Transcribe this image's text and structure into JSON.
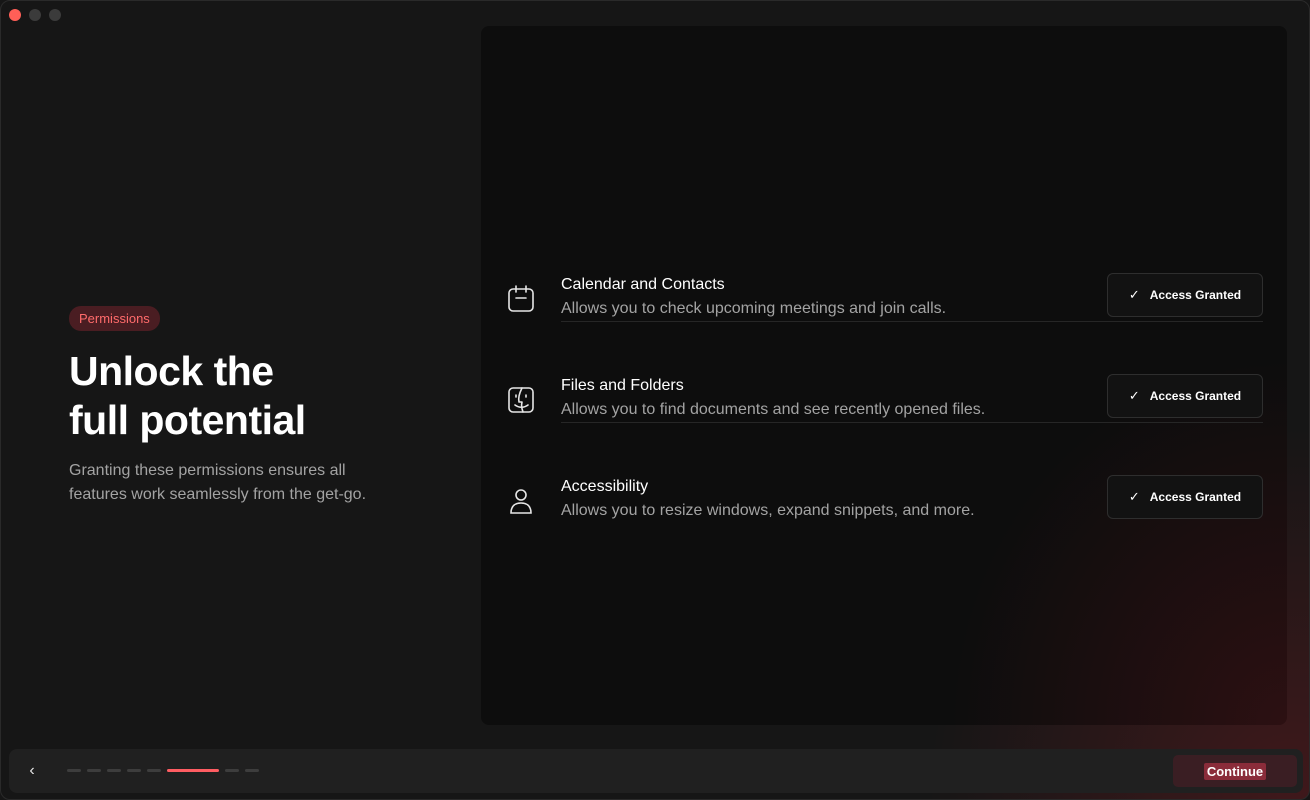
{
  "header": {
    "badge": "Permissions",
    "title_line1": "Unlock the",
    "title_line2": "full potential",
    "subtitle_line1": "Granting these permissions ensures all",
    "subtitle_line2": "features work seamlessly from the get-go."
  },
  "permissions": [
    {
      "icon": "calendar-icon",
      "name": "Calendar and Contacts",
      "description": "Allows you to check upcoming meetings and join calls.",
      "status": "Access Granted"
    },
    {
      "icon": "finder-icon",
      "name": "Files and Folders",
      "description": "Allows you to find documents and see recently opened files.",
      "status": "Access Granted"
    },
    {
      "icon": "person-icon",
      "name": "Accessibility",
      "description": "Allows you to resize windows, expand snippets, and more.",
      "status": "Access Granted"
    }
  ],
  "footer": {
    "back_icon": "chevron-left-icon",
    "continue_label": "Continue",
    "steps_total": 8,
    "active_step": 6
  },
  "colors": {
    "accent": "#ff5d62",
    "badge_bg": "#4a1d22",
    "continue_bg": "#3a1e23"
  }
}
